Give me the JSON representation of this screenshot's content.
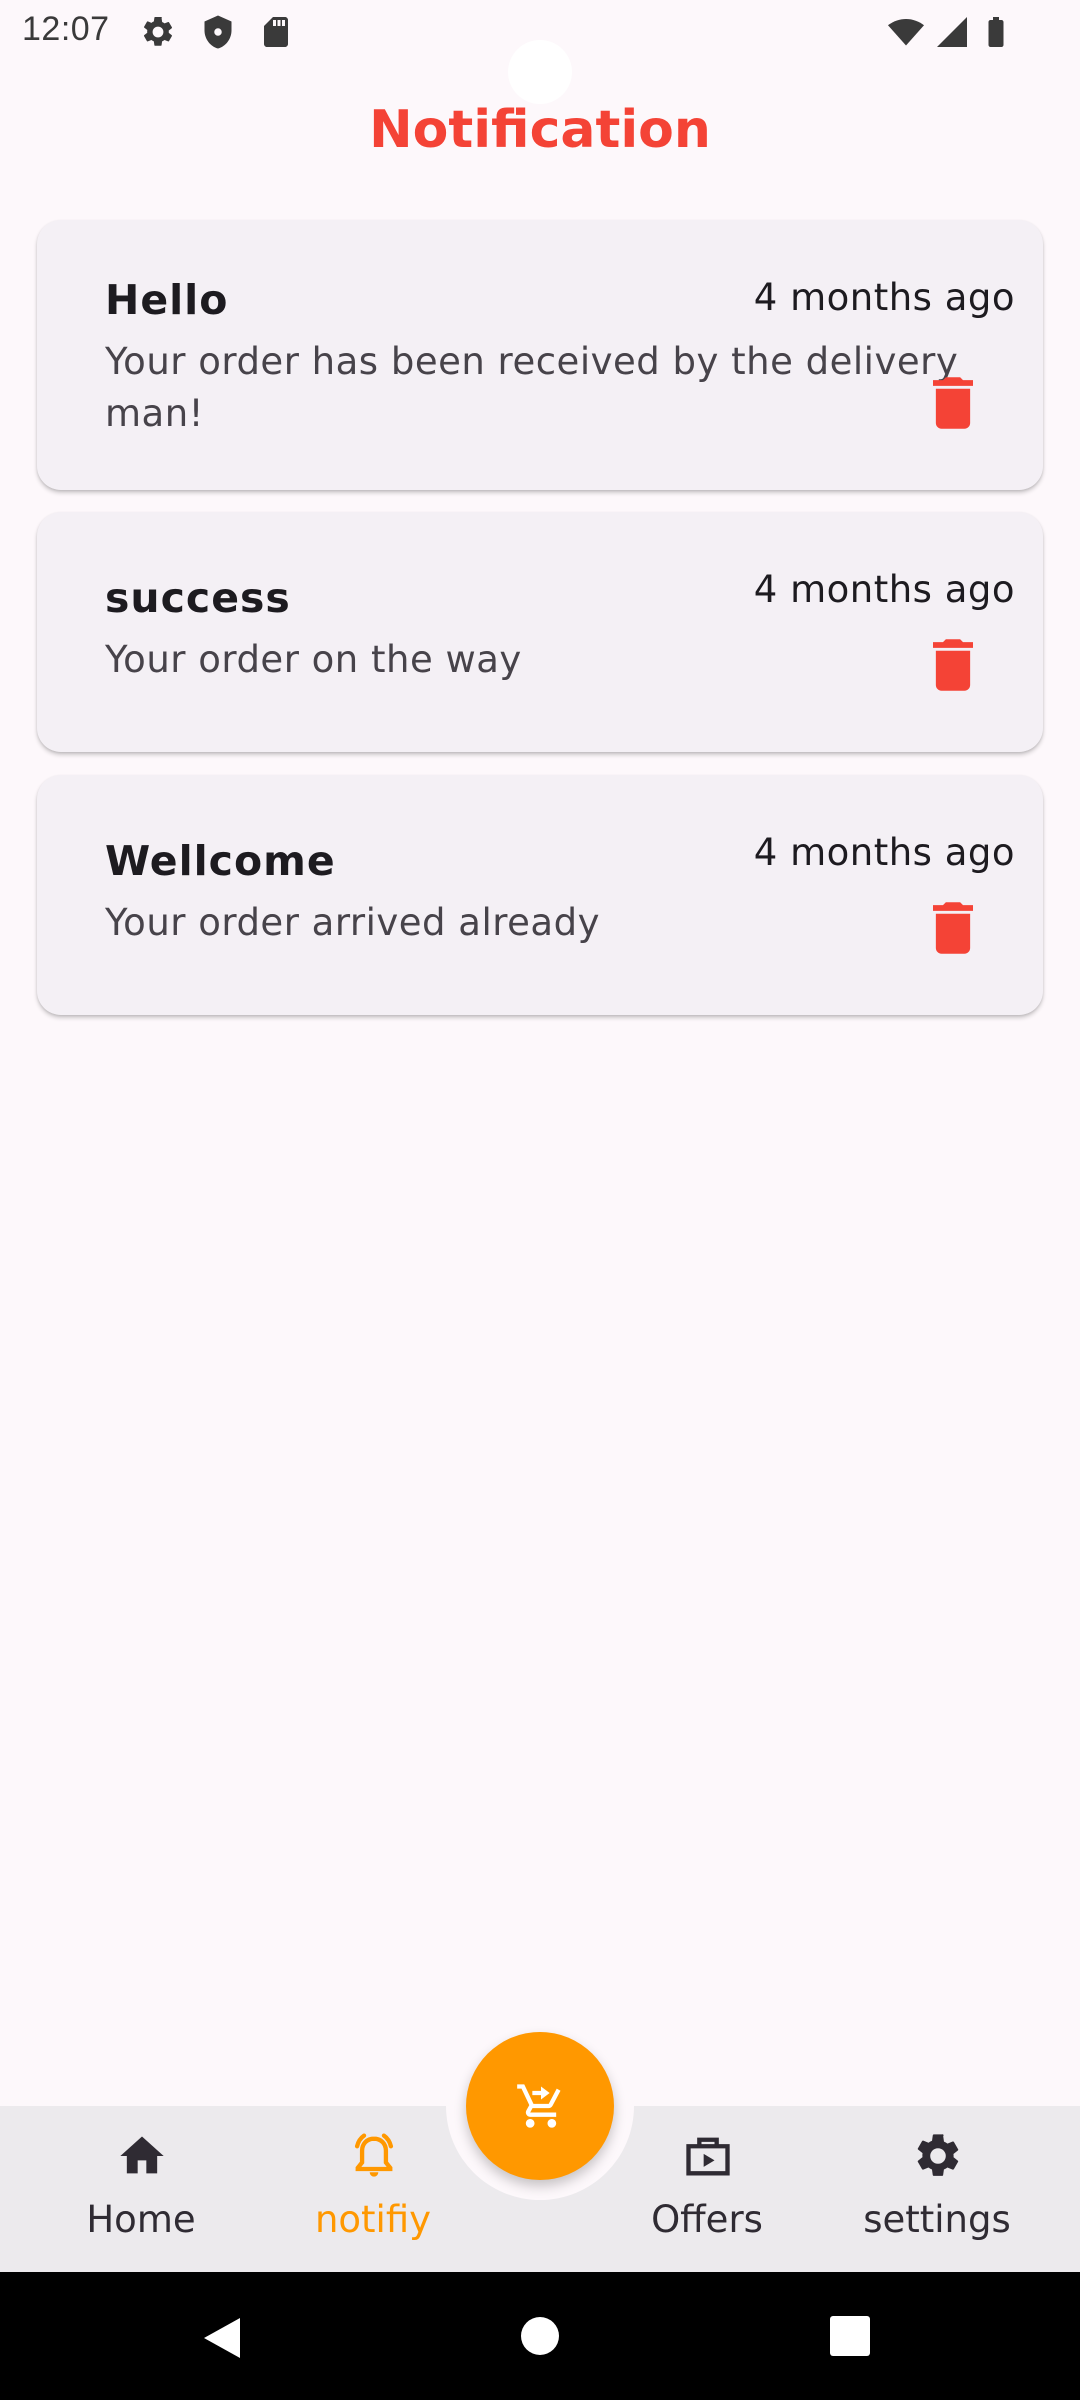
{
  "status_bar": {
    "time": "12:07",
    "icons": [
      "gear-icon",
      "shield-icon",
      "sd-card-icon",
      "wifi-icon",
      "signal-icon",
      "battery-icon"
    ]
  },
  "header": {
    "title": "Notification"
  },
  "notifications": [
    {
      "title": "Hello",
      "time": "4 months ago",
      "body": "Your order has been received by the delivery man!",
      "action_icon": "trash-icon"
    },
    {
      "title": "success",
      "time": "4 months ago",
      "body": "Your order on the way",
      "action_icon": "trash-icon"
    },
    {
      "title": "Wellcome",
      "time": "4 months ago",
      "body": "Your order arrived already",
      "action_icon": "trash-icon"
    }
  ],
  "bottom_nav": {
    "items": [
      {
        "label": "Home",
        "icon": "home-icon",
        "active": false
      },
      {
        "label": "notifiy",
        "icon": "bell-icon",
        "active": true
      },
      {
        "label": "Offers",
        "icon": "offers-icon",
        "active": false
      },
      {
        "label": "settings",
        "icon": "gear-icon",
        "active": false
      }
    ],
    "fab_icon": "cart-icon"
  },
  "colors": {
    "accent": "#ff9800",
    "title": "#f44336",
    "delete": "#f44336",
    "card_bg": "#f4f0f5",
    "page_bg": "#fdf8fb",
    "nav_bg": "#eceaed"
  }
}
